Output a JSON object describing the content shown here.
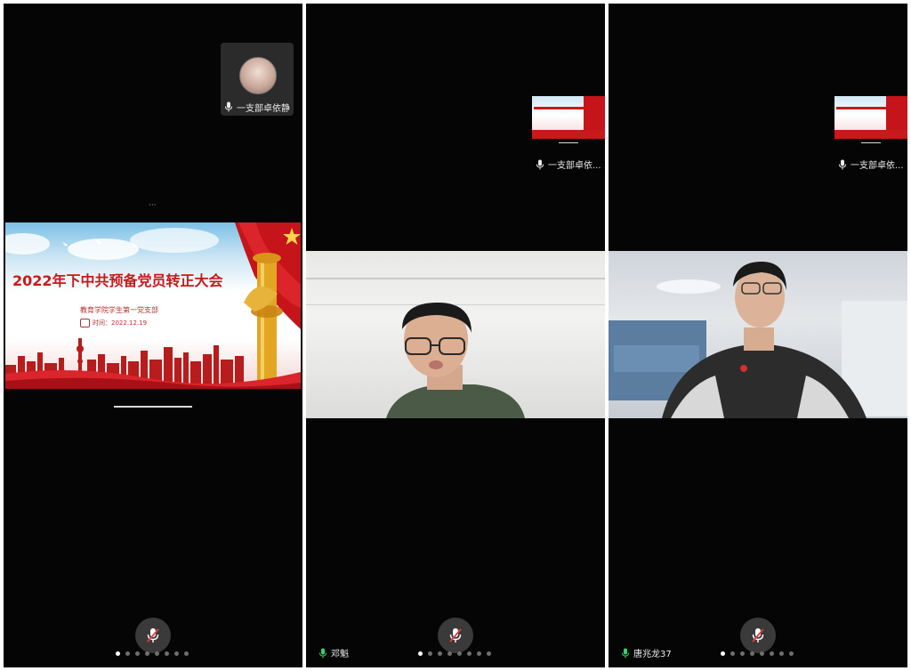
{
  "slide": {
    "title": "2022年下中共预备党员转正大会",
    "organizer": "教育学院学生第一党支部",
    "date_label": "时间：2022.12.19"
  },
  "panels": [
    {
      "floating_tile_name": "一支部卓依静",
      "local_name": "",
      "dots_total": 8,
      "dots_active_index": 0
    },
    {
      "floating_tile_name": "一支部卓依...",
      "local_name": "邓魁",
      "dots_total": 8,
      "dots_active_index": 0
    },
    {
      "floating_tile_name": "一支部卓依...",
      "local_name": "唐兆龙37",
      "dots_total": 8,
      "dots_active_index": 0
    }
  ],
  "colors": {
    "background": "#050505",
    "slide_red": "#c81a1a",
    "mic_muted": "#e03c3c",
    "mic_active": "#3ccf6a"
  },
  "icons": {
    "mic": "mic-icon",
    "mic_muted": "mic-off-icon"
  }
}
